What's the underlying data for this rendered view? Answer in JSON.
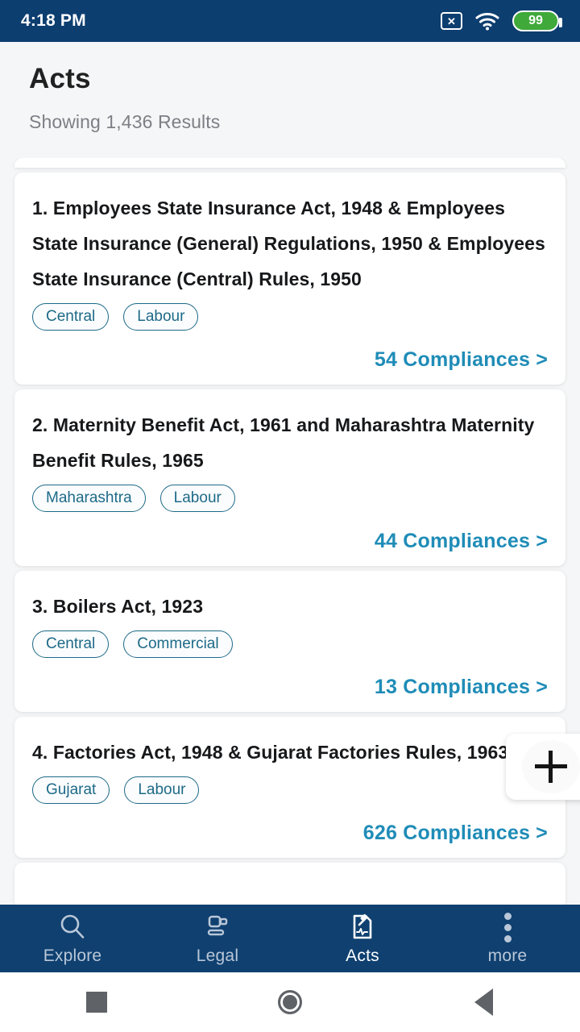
{
  "status_bar": {
    "time": "4:18 PM",
    "no_sim_icon": "no-sim-icon",
    "wifi_icon": "wifi-icon",
    "battery_level": "99"
  },
  "header": {
    "title": "Acts",
    "results_text": "Showing 1,436 Results"
  },
  "acts": [
    {
      "title": "1. Employees State Insurance Act, 1948 & Employees State Insurance (General) Regulations, 1950 & Employees State Insurance (Central) Rules, 1950",
      "tags": [
        "Central",
        "Labour"
      ],
      "compliances": "54 Compliances >"
    },
    {
      "title": "2. Maternity Benefit Act, 1961 and Maharashtra Maternity Benefit Rules, 1965",
      "tags": [
        "Maharashtra",
        "Labour"
      ],
      "compliances": "44 Compliances >"
    },
    {
      "title": "3. Boilers Act, 1923",
      "tags": [
        "Central",
        "Commercial"
      ],
      "compliances": "13 Compliances >"
    },
    {
      "title": "4. Factories Act, 1948 & Gujarat Factories Rules, 1963",
      "tags": [
        "Gujarat",
        "Labour"
      ],
      "compliances": "626 Compliances >"
    }
  ],
  "fab": {
    "icon": "plus-icon"
  },
  "bottom_nav": {
    "items": [
      {
        "label": "Explore",
        "icon": "search-icon",
        "active": false
      },
      {
        "label": "Legal",
        "icon": "gavel-icon",
        "active": false
      },
      {
        "label": "Acts",
        "icon": "document-gavel-icon",
        "active": true
      },
      {
        "label": "more",
        "icon": "overflow-dots-icon",
        "active": false
      }
    ]
  },
  "android_nav": {
    "recents": "square-icon",
    "home": "circle-icon",
    "back": "triangle-back-icon"
  },
  "colors": {
    "brand_blue": "#0f4070",
    "status_blue": "#0d3e70",
    "link_blue": "#1f8cb7",
    "tag_teal": "#1d6a88",
    "battery_green": "#3fa93a",
    "page_bg": "#f5f6f7"
  }
}
